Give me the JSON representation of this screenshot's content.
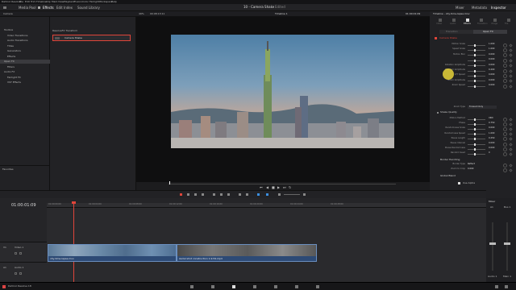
{
  "menubar": {
    "items": [
      "DaVinci Resolve",
      "File",
      "Edit",
      "Trim",
      "Timeline",
      "Clip",
      "Mark",
      "View",
      "Playback",
      "Fusion",
      "Color",
      "Fairlight",
      "Workspace",
      "Help"
    ]
  },
  "toolbar": {
    "media_pool": "Media Pool",
    "effects": "Effects",
    "edit_index": "Edit Index",
    "sound_library": "Sound Library",
    "project": "10 - Camera Shake",
    "status": "Edited",
    "mixer": "Mixer",
    "metadata": "Metadata",
    "inspector": "Inspector"
  },
  "effects_panel": {
    "tab": "Camera",
    "tree": [
      {
        "label": "Toolbox",
        "indent": 0,
        "selected": false
      },
      {
        "label": "Video Transitions",
        "indent": 1,
        "selected": false
      },
      {
        "label": "Audio Transitions",
        "indent": 1,
        "selected": false
      },
      {
        "label": "Titles",
        "indent": 1,
        "selected": false
      },
      {
        "label": "Generators",
        "indent": 1,
        "selected": false
      },
      {
        "label": "Effects",
        "indent": 1,
        "selected": false
      },
      {
        "label": "Open FX",
        "indent": 0,
        "selected": true
      },
      {
        "label": "Filters",
        "indent": 1,
        "selected": false
      },
      {
        "label": "Audio FX",
        "indent": 0,
        "selected": false
      },
      {
        "label": "Fairlight FX",
        "indent": 1,
        "selected": false
      },
      {
        "label": "VST Effects",
        "indent": 1,
        "selected": false
      }
    ],
    "favorites": "Favorites",
    "group": "ResolveFX Transform",
    "result": "Camera Shake"
  },
  "viewer": {
    "zoom": "49%",
    "timecode_left": "00:08:13:11",
    "timeline": "Timeline 1",
    "timecode_right": "01:00:01:09"
  },
  "inspector": {
    "title": "Timeline - city-time-lapse.mov",
    "tabs": [
      "Video",
      "Audio",
      "Effects",
      "Transition",
      "Image",
      "File"
    ],
    "subtabs": [
      "Transition",
      "Open FX"
    ],
    "effect": "Camera Shake",
    "params": [
      {
        "label": "Motion Scale",
        "value": "1.000"
      },
      {
        "label": "Speed Scale",
        "value": "1.000"
      },
      {
        "label": "Motion Blur",
        "value": "0.000"
      },
      {
        "label": "",
        "value": "0.000"
      },
      {
        "label": "Rotation Amplitude",
        "value": "0.000"
      },
      {
        "label": "Random Amplitude",
        "value": "0.200"
      },
      {
        "label": "X/Y Speed",
        "value": "0.000"
      },
      {
        "label": "Zoom Amplitude",
        "value": "0.000"
      },
      {
        "label": "Zoom Speed",
        "value": "0.000"
      }
    ],
    "zoom_type_label": "Zoom Type",
    "zoom_type_value": "Forward Only",
    "shake_quality": "Shake Quality",
    "quality_params": [
      {
        "label": "Motion Method",
        "value": "XRD"
      },
      {
        "label": "Phase",
        "value": "0.750"
      },
      {
        "label": "Randomness Scale",
        "value": "0.000"
      },
      {
        "label": "Randomness Speed",
        "value": "1.000"
      },
      {
        "label": "Pause Length",
        "value": "0.250"
      },
      {
        "label": "Pause Interval",
        "value": "0.000"
      },
      {
        "label": "Pause Randomness",
        "value": "0.000"
      },
      {
        "label": "Random Seed",
        "value": "0"
      }
    ],
    "border_section": "Border Handling",
    "border_params": [
      {
        "label": "Border Type",
        "value": "Reflect"
      },
      {
        "label": "Zoom to Crop",
        "value": "0.000"
      }
    ],
    "global_section": "Global Blend",
    "use_alpha": "Use Alpha"
  },
  "timeline": {
    "timecode": "01:00:01:09",
    "ruler": [
      "01:00:00:00",
      "01:00:04:00",
      "01:00:08:00",
      "01:00:12:00",
      "01:00:16:00",
      "01:00:20:00",
      "01:00:24:00",
      "01:00:28:00"
    ],
    "track_v1": "Video 1",
    "track_a1": "Audio 1",
    "v1_tag": "V1",
    "a1_tag": "A1",
    "clip1": "city-time-lapse.mov",
    "clip2": "Aerial shot construction 1.9.59.mp4"
  },
  "mixer": {
    "title": "Mixer",
    "a1": "A1",
    "bus1": "Bus 1",
    "audio1": "Audio 1",
    "main": "Main 1"
  },
  "footer": {
    "app": "DaVinci Resolve 18"
  },
  "colors": {
    "accent": "#e0453a",
    "clip": "#2d4a75",
    "highlight": "#e6d23a"
  }
}
